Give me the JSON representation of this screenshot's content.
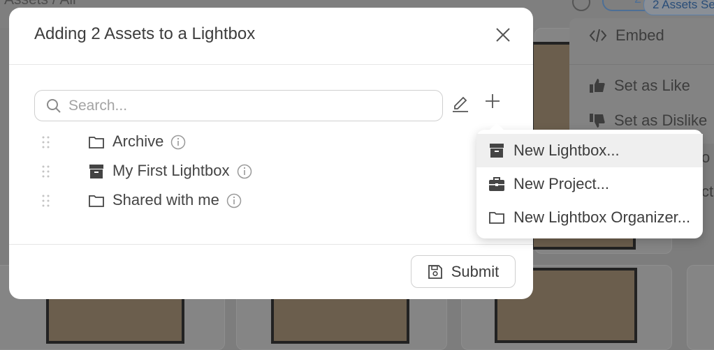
{
  "background": {
    "breadcrumb": "Assets / All",
    "toolbar_count": "2",
    "selection_pill": "2 Assets Se",
    "menu": {
      "embed": "Embed",
      "like": "Set as Like",
      "dislike": "Set as Dislike",
      "partial1": "o",
      "partial2": "cti"
    }
  },
  "modal": {
    "title": "Adding 2 Assets to a Lightbox",
    "search_placeholder": "Search...",
    "tree": [
      {
        "label": "Archive",
        "icon": "folder-icon"
      },
      {
        "label": "My First Lightbox",
        "icon": "archive-box-icon"
      },
      {
        "label": "Shared with me",
        "icon": "folder-icon"
      }
    ],
    "submit_label": "Submit"
  },
  "dropdown": {
    "items": [
      {
        "label": "New Lightbox...",
        "icon": "archive-box-icon",
        "active": true
      },
      {
        "label": "New Project...",
        "icon": "briefcase-icon",
        "active": false
      },
      {
        "label": "New Lightbox Organizer...",
        "icon": "folder-icon",
        "active": false
      }
    ]
  }
}
